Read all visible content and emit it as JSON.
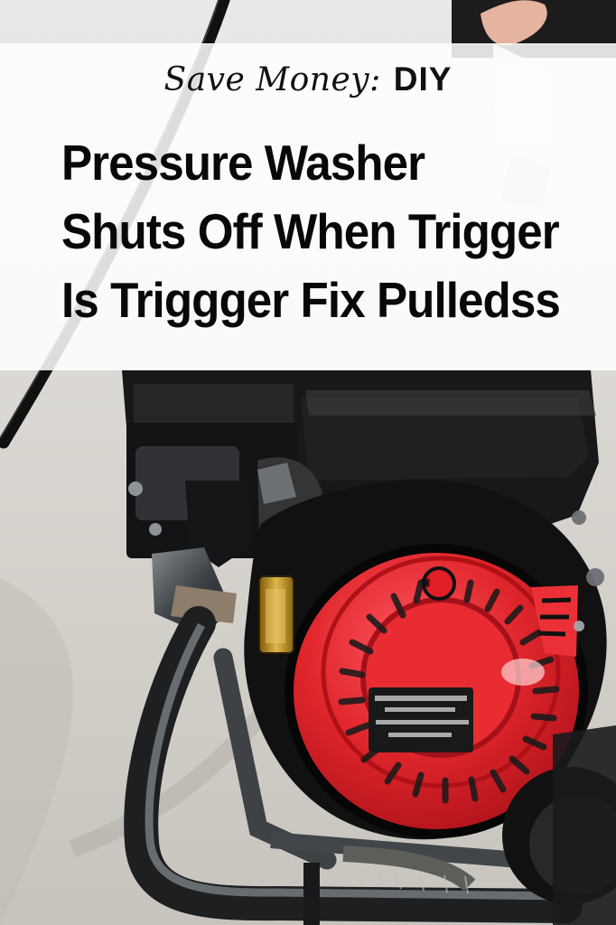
{
  "kicker": {
    "script_text": "Save Money:",
    "bold_text": "DIY"
  },
  "headline": {
    "lines": [
      "Pressure Washer",
      "Shuts Off When Trigger",
      "Is Triggger  Fix Pulledss"
    ]
  },
  "colors": {
    "overlay": "#ffffff",
    "text": "#080808",
    "engine_red": "#e3242b",
    "engine_black": "#151515",
    "frame_gray": "#5a5d60"
  }
}
